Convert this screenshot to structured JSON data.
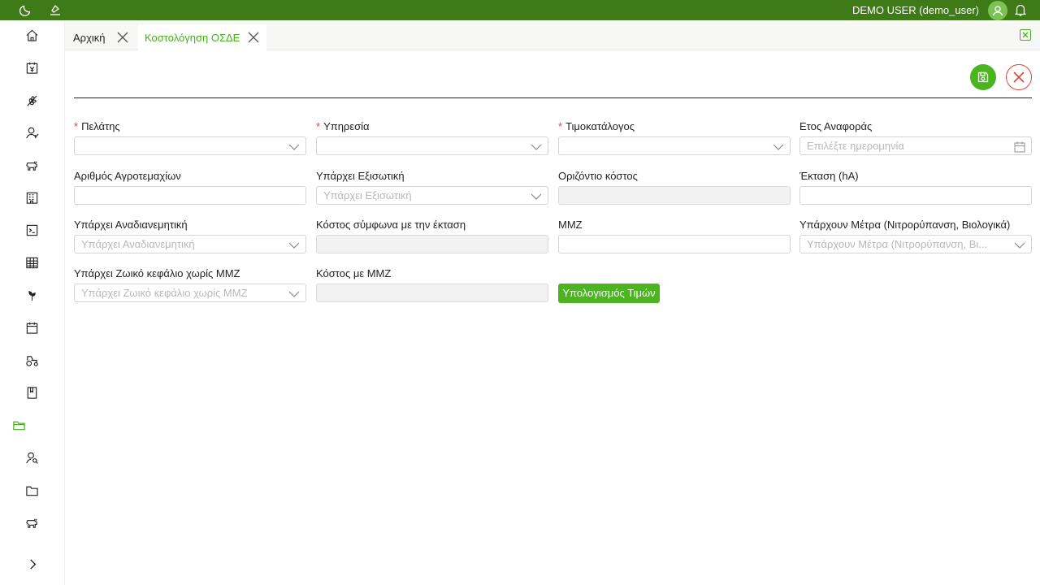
{
  "topbar": {
    "user_label": "DEMO USER (demo_user)",
    "left_icons": [
      "moon-icon",
      "theme-icon"
    ],
    "bg_color": "#3f7a18"
  },
  "sidebar": {
    "icons": [
      "home-icon",
      "yen-calendar-icon",
      "wheat-icon",
      "user-icon",
      "cow-icon",
      "building-icon",
      "terminal-icon",
      "table-icon",
      "plant-icon",
      "calendar-icon",
      "tractor-icon",
      "book-icon",
      "folder-icon-active",
      "user-search-icon",
      "folder-icon",
      "cow-icon-2"
    ],
    "expand_icon": "chevron-right-icon"
  },
  "tabs": [
    {
      "label": "Αρχική",
      "active": false
    },
    {
      "label": "Κοστολόγηση ΟΣΔΕ",
      "active": true
    }
  ],
  "form": {
    "fields": {
      "customer": {
        "label": "Πελάτης",
        "required": true,
        "value": "",
        "placeholder": ""
      },
      "service": {
        "label": "Υπηρεσία",
        "required": true,
        "value": "",
        "placeholder": ""
      },
      "pricelist": {
        "label": "Τιμοκατάλογος",
        "required": true,
        "value": "",
        "placeholder": ""
      },
      "ref_year": {
        "label": "Ετος Αναφοράς",
        "required": false,
        "value": "",
        "placeholder": "Επιλέξτε ημερομηνία"
      },
      "parcels_count": {
        "label": "Αριθμός Αγροτεμαχίων",
        "required": false,
        "value": "",
        "placeholder": ""
      },
      "equalizing": {
        "label": "Υπάρχει Εξισωτική",
        "required": false,
        "value": "",
        "placeholder": "Υπάρχει Εξισωτική"
      },
      "horizontal_cost": {
        "label": "Οριζόντιο κόστος",
        "required": false,
        "value": "",
        "placeholder": ""
      },
      "area": {
        "label": "Έκταση (hA)",
        "required": false,
        "value": "",
        "placeholder": ""
      },
      "redistributive": {
        "label": "Υπάρχει Αναδιανεμητική",
        "required": false,
        "value": "",
        "placeholder": "Υπάρχει Αναδιανεμητική"
      },
      "area_cost": {
        "label": "Κόστος σύμφωνα με την έκταση",
        "required": false,
        "value": "",
        "placeholder": ""
      },
      "mmz": {
        "label": "ΜΜΖ",
        "required": false,
        "value": "",
        "placeholder": ""
      },
      "measures": {
        "label": "Υπάρχουν Μέτρα (Νιτρορύπανση, Βιολογικά)",
        "required": false,
        "value": "",
        "placeholder": "Υπάρχουν Μέτρα (Νιτρορύπανση, Βι..."
      },
      "livestock": {
        "label": "Υπάρχει Ζωικό κεφάλιο χωρίς ΜΜΖ",
        "required": false,
        "value": "",
        "placeholder": "Υπάρχει Ζωικό κεφάλιο χωρίς ΜΜΖ"
      },
      "mmz_cost": {
        "label": "Κόστος με ΜΜΖ",
        "required": false,
        "value": "",
        "placeholder": ""
      }
    },
    "calc_button": "Υπολογισμός Τιμών"
  },
  "colors": {
    "accent": "#4ab51e",
    "required": "#e0453b",
    "close": "#e0453b"
  }
}
